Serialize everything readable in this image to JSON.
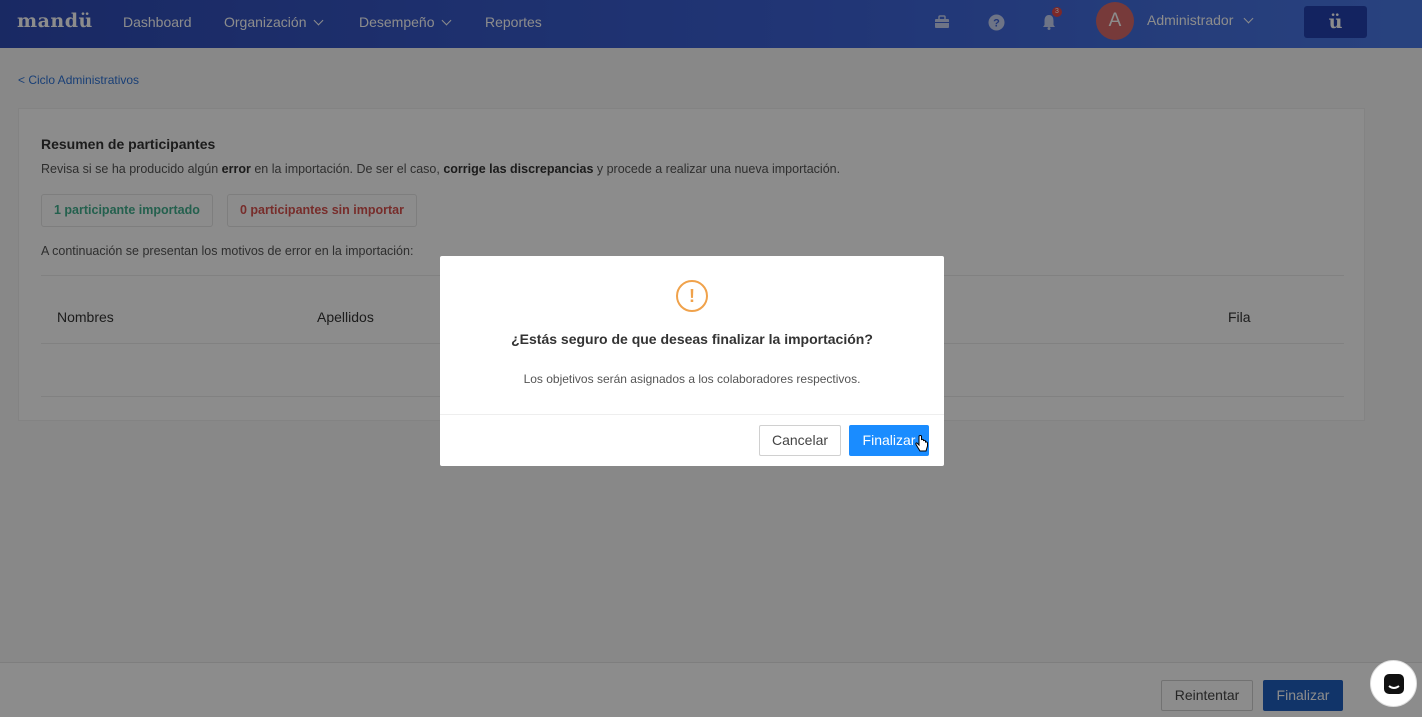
{
  "nav": {
    "logo": "mandü",
    "items": [
      {
        "label": "Dashboard"
      },
      {
        "label": "Organización"
      },
      {
        "label": "Desempeño"
      },
      {
        "label": "Reportes"
      }
    ],
    "icons": [
      "briefcase-icon",
      "help-icon",
      "bell-icon"
    ],
    "notification_count": "3",
    "avatar_letter": "A",
    "user_name": "Administrador",
    "brand_button": "ü"
  },
  "breadcrumb": "< Ciclo Administrativos",
  "summary": {
    "title": "Resumen de participantes",
    "desc_part1": "Revisa si se ha producido algún ",
    "desc_bold1": "error",
    "desc_part2": " en la importación. De ser el caso, ",
    "desc_bold2": "corrige las discrepancias",
    "desc_part3": " y procede a realizar una nueva importación.",
    "imported_label": "1 participante importado",
    "not_imported_label": "0 participantes sin importar",
    "reason_text": "A continuación se presentan los motivos de error en la importación:",
    "columns": [
      "Nombres",
      "Apellidos",
      "Fila"
    ]
  },
  "footer": {
    "retry_label": "Reintentar",
    "finish_label": "Finalizar"
  },
  "modal": {
    "icon": "!",
    "title": "¿Estás seguro de que deseas finalizar la importación?",
    "body": "Los objetivos serán asignados a los colaboradores respectivos.",
    "cancel_label": "Cancelar",
    "confirm_label": "Finalizar"
  },
  "colors": {
    "nav_bg": "#3d63d8",
    "primary": "#1a8cff",
    "success": "#43b08e",
    "error": "#d9534f",
    "warning": "#f0a24b"
  }
}
